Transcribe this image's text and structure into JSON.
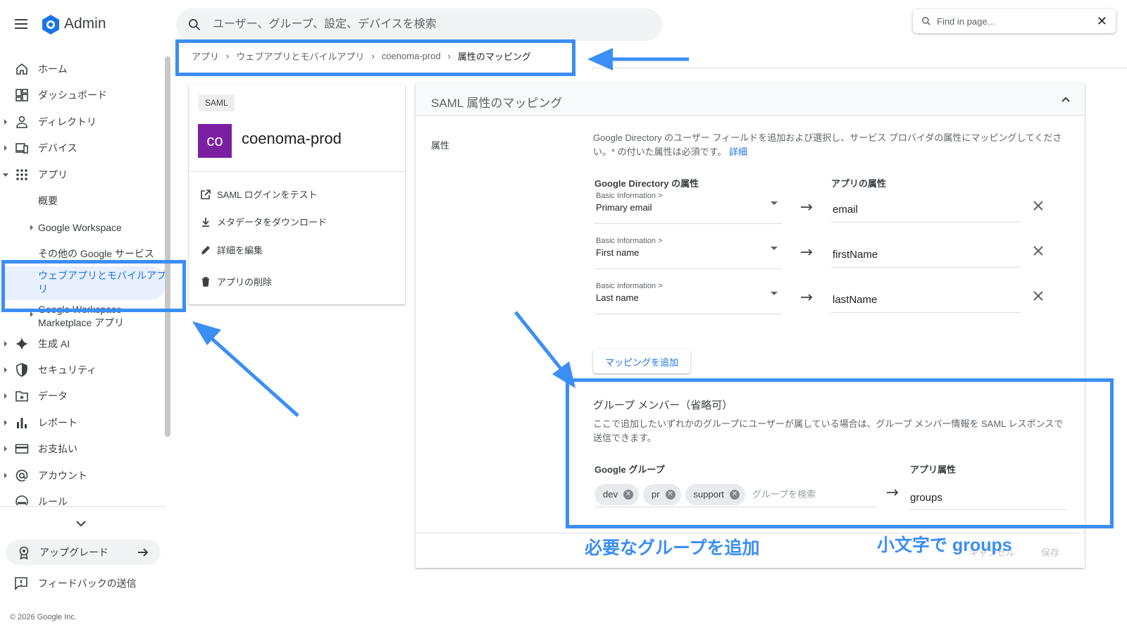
{
  "header": {
    "app_name": "Admin",
    "search_placeholder": "ユーザー、グループ、設定、デバイスを検索",
    "find_placeholder": "Find in page..."
  },
  "sidebar": {
    "items": [
      {
        "label": "ホーム",
        "icon": "home-icon"
      },
      {
        "label": "ダッシュボード",
        "icon": "dashboard-icon"
      },
      {
        "label": "ディレクトリ",
        "icon": "person-icon"
      },
      {
        "label": "デバイス",
        "icon": "devices-icon"
      },
      {
        "label": "アプリ",
        "icon": "apps-grid-icon"
      },
      {
        "label": "概要"
      },
      {
        "label": "Google Workspace"
      },
      {
        "label": "その他の Google サービス"
      },
      {
        "label": "ウェブアプリとモバイルアプリ"
      },
      {
        "label": "Google Workspace Marketplace アプリ"
      },
      {
        "label": "生成 AI",
        "icon": "sparkle-icon"
      },
      {
        "label": "セキュリティ",
        "icon": "shield-icon"
      },
      {
        "label": "データ",
        "icon": "folder-icon"
      },
      {
        "label": "レポート",
        "icon": "bar-chart-icon"
      },
      {
        "label": "お支払い",
        "icon": "credit-card-icon"
      },
      {
        "label": "アカウント",
        "icon": "at-sign-icon"
      },
      {
        "label": "ルール",
        "icon": "rules-icon"
      }
    ],
    "upgrade_label": "アップグレード",
    "feedback_label": "フィードバックの送信",
    "copyright": "© 2026 Google Inc."
  },
  "breadcrumb": [
    "アプリ",
    "ウェブアプリとモバイルアプリ",
    "coenoma-prod",
    "属性のマッピング"
  ],
  "app_card": {
    "tag": "SAML",
    "avatar_text": "co",
    "name": "coenoma-prod",
    "actions": [
      "SAML ログインをテスト",
      "メタデータをダウンロード",
      "詳細を編集",
      "アプリの削除"
    ]
  },
  "mapping": {
    "title": "SAML 属性のマッピング",
    "attr_label": "属性",
    "description": "Google Directory のユーザー フィールドを追加および選択し、サービス プロバイダの属性にマッピングしてください。* の付いた属性は必須です。",
    "details_link": "詳細",
    "col_directory": "Google Directory の属性",
    "col_app": "アプリの属性",
    "rows": [
      {
        "category": "Basic Information >",
        "field": "Primary email",
        "app_attr": "email"
      },
      {
        "category": "Basic Information >",
        "field": "First name",
        "app_attr": "firstName"
      },
      {
        "category": "Basic Information >",
        "field": "Last name",
        "app_attr": "lastName"
      }
    ],
    "add_mapping": "マッピングを追加",
    "group_title": "グループ メンバー（省略可）",
    "group_desc": "ここで追加したいずれかのグループにユーザーが属している場合は、グループ メンバー情報を SAML レスポンスで送信できます。",
    "group_col": "Google グループ",
    "group_app_col": "アプリ属性",
    "groups": [
      "dev",
      "pr",
      "support"
    ],
    "group_search_placeholder": "グループを検索",
    "group_app_attr": "groups",
    "cancel": "キャンセル",
    "save": "保存"
  },
  "annotations": {
    "add_groups": "必要なグループを追加",
    "lowercase_groups": "小文字で groups",
    "color": "#3b8ef5"
  },
  "colors": {
    "accent": "#1a73e8",
    "avatar": "#7b1fa2",
    "active_bg": "#e8f0fe"
  }
}
